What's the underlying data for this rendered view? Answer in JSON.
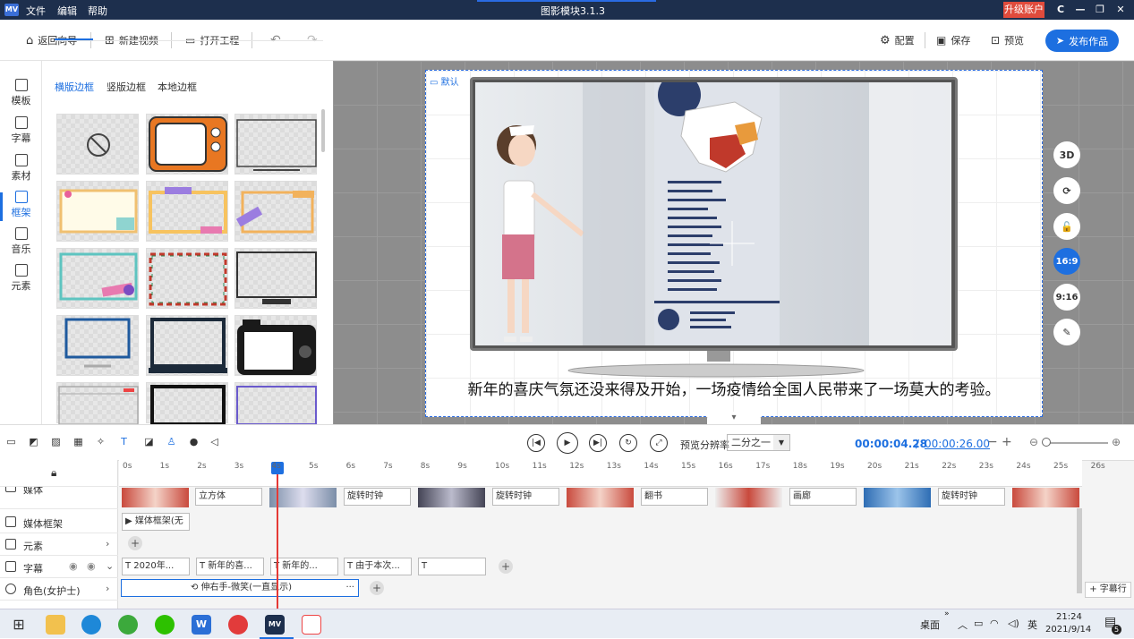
{
  "titlebar": {
    "logo": "MV",
    "menus": [
      "文件",
      "编辑",
      "帮助"
    ],
    "title": "图影模块3.1.3",
    "upgrade": "升级账户",
    "window_buttons": [
      "C",
      "—",
      "❐",
      "✕"
    ]
  },
  "toolbar": {
    "back": "返回向导",
    "new_video": "新建视频",
    "open_project": "打开工程",
    "config": "配置",
    "save": "保存",
    "preview": "预览",
    "publish": "发布作品"
  },
  "leftnav": {
    "items": [
      {
        "label": "模板",
        "icon": "template-icon"
      },
      {
        "label": "字幕",
        "icon": "caption-icon"
      },
      {
        "label": "素材",
        "icon": "image-icon"
      },
      {
        "label": "框架",
        "icon": "frame-icon",
        "active": true
      },
      {
        "label": "音乐",
        "icon": "music-icon"
      },
      {
        "label": "元素",
        "icon": "elements-icon"
      }
    ]
  },
  "panel": {
    "tabs": [
      "横版边框",
      "竖版边框",
      "本地边框"
    ],
    "active_tab": "横版边框"
  },
  "canvas": {
    "default_label": "默认",
    "subtitle": "新年的喜庆气氛还没来得及开始，一场疫情给全国人民带来了一场莫大的考验。",
    "right_buttons": [
      "3D",
      "⟳",
      "🔓",
      "16:9",
      "9:16",
      "✎"
    ],
    "active_ratio": "16:9"
  },
  "playback": {
    "preview_resolution_label": "预览分辨率",
    "preview_resolution_value": "二分之一",
    "time_current": "00:00:04.28",
    "time_separator": "/",
    "time_total": "00:00:26.00",
    "zoom_minus": "−",
    "zoom_plus": "+"
  },
  "timeline": {
    "ruler_ticks": [
      "0s",
      "1s",
      "2s",
      "3s",
      "4s",
      "5s",
      "6s",
      "7s",
      "8s",
      "9s",
      "10s",
      "11s",
      "12s",
      "13s",
      "14s",
      "15s",
      "16s",
      "17s",
      "18s",
      "19s",
      "20s",
      "21s",
      "22s",
      "23s",
      "24s",
      "25s",
      "26s"
    ],
    "tracks": [
      {
        "label": "媒体"
      },
      {
        "label": "媒体框架"
      },
      {
        "label": "元素"
      },
      {
        "label": "字幕"
      },
      {
        "label": "角色(女护士)"
      }
    ],
    "media_clips": [
      "立方体",
      "旋转时钟",
      "旋转时钟",
      "翻书",
      "画廊",
      "旋转时钟"
    ],
    "frame_clip": "媒体框架(无",
    "subtitle_clips": [
      "2020年...",
      "新年的喜...",
      "新年的...",
      "由于本次...",
      ""
    ],
    "role_clip": "伸右手-微笑(一直显示)",
    "add_subtitle_row": "+ 字幕行"
  },
  "taskbar": {
    "desktop_label": "桌面",
    "lang": "英",
    "time": "21:24",
    "date": "2021/9/14",
    "notifications": "5"
  }
}
